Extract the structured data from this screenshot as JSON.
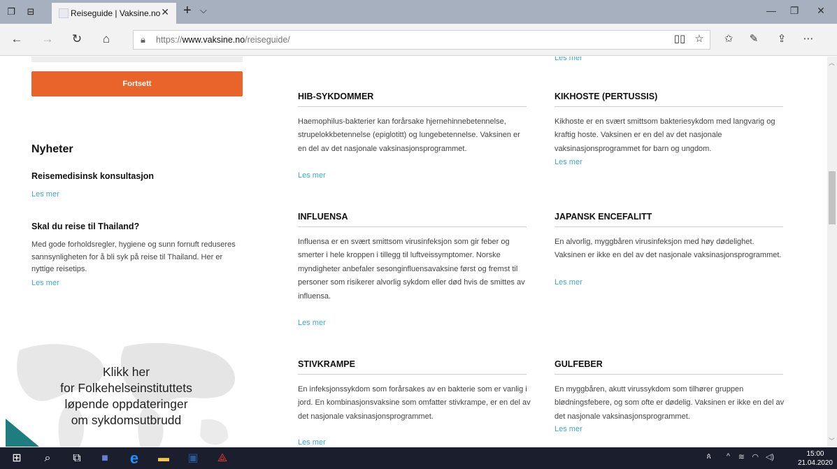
{
  "browser": {
    "tab_title": "Reiseguide | Vaksine.no",
    "url_prefix": "https://",
    "url_domain": "www.vaksine.no",
    "url_path": "/reiseguide/"
  },
  "sidebar": {
    "continue_label": "Fortsett",
    "news_heading": "Nyheter",
    "news": [
      {
        "title": "Reisemedisinsk konsultasjon",
        "text": "",
        "link": "Les mer"
      },
      {
        "title": "Skal du reise til Thailand?",
        "text": "Med gode forholdsregler, hygiene og sunn fornuft reduseres sannsynligheten for å bli syk på reise til Thailand. Her er nyttige reisetips.",
        "link": "Les mer"
      }
    ],
    "promo_lines": [
      "Klikk her",
      "for Folkehelseinstituttets",
      "løpende oppdateringer",
      "om sykdomsutbrudd"
    ]
  },
  "top_link": "Les mer",
  "diseases": [
    {
      "title": "HIB-SYKDOMMER",
      "text": "Haemophilus-bakterier kan forårsake hjernehinnebetennelse, strupelokkbetennelse (epiglotitt) og lungebetennelse. Vaksinen er en del av det nasjonale vaksinasjonsprogrammet.",
      "link": "Les mer"
    },
    {
      "title": "KIKHOSTE (PERTUSSIS)",
      "text": "Kikhoste er en svært smittsom bakteriesykdom med langvarig og kraftig hoste. Vaksinen er en del av det nasjonale vaksinasjonsprogrammet for barn og ungdom.",
      "link": "Les mer"
    },
    {
      "title": "INFLUENSA",
      "text": "Influensa er en svært smittsom virusinfeksjon som gir feber og smerter i hele kroppen i tillegg til luftveissymptomer. Norske myndigheter anbefaler sesonginfluensavaksine først og fremst til personer som risikerer alvorlig sykdom eller død hvis de smittes av influensa.",
      "link": "Les mer"
    },
    {
      "title": "JAPANSK ENCEFALITT",
      "text": "En alvorlig, myggbåren virusinfeksjon med høy dødelighet. Vaksinen er ikke en del av det nasjonale vaksinasjonsprogrammet.",
      "link": "Les mer"
    },
    {
      "title": "STIVKRAMPE",
      "text": "En infeksjonssykdom som forårsakes av en bakterie som er vanlig i jord. En kombinasjonsvaksine som omfatter stivkrampe, er en del av det nasjonale vaksinasjonsprogrammet.",
      "link": "Les mer"
    },
    {
      "title": "GULFEBER",
      "text": "En myggbåren, akutt virussykdom som tilhører gruppen blødningsfebere, og som ofte er dødelig. Vaksinen er ikke en del av det nasjonale vaksinasjonsprogrammet.",
      "link": "Les mer"
    }
  ],
  "taskbar": {
    "time": "15:00",
    "date": "21.04.2020"
  },
  "colors": {
    "accent_orange": "#e8642a",
    "link_blue": "#3ea8c9",
    "teal": "#1e7d7e"
  }
}
